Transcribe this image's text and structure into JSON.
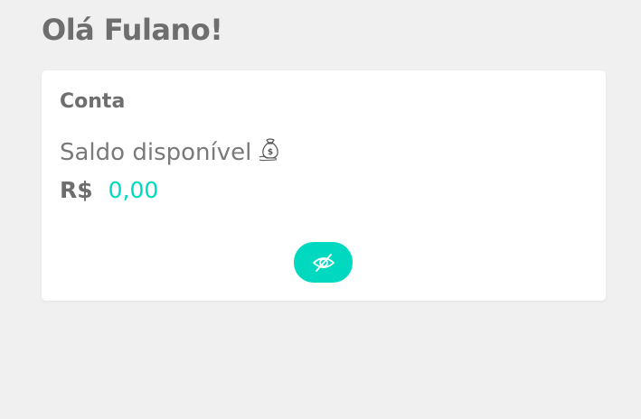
{
  "header": {
    "greeting": "Olá Fulano!"
  },
  "account_card": {
    "title": "Conta",
    "balance_label": "Saldo disponível",
    "balance_icon": "money-bag-icon",
    "currency": "R$",
    "balance_value": "0,00",
    "toggle_visibility_icon": "eye-slash-icon"
  },
  "colors": {
    "background": "#f0f0f0",
    "card": "#ffffff",
    "text": "#6e6e6e",
    "accent": "#00d9c0"
  }
}
